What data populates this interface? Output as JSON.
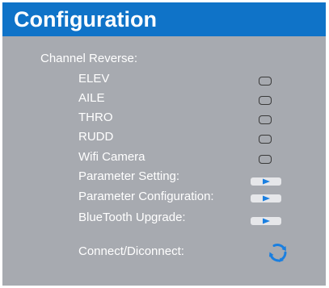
{
  "header": {
    "title": "Configuration"
  },
  "channel_reverse": {
    "label": "Channel Reverse:",
    "items": [
      {
        "label": "ELEV",
        "checked": false
      },
      {
        "label": "AILE",
        "checked": false
      },
      {
        "label": "THRO",
        "checked": false
      },
      {
        "label": "RUDD",
        "checked": false
      },
      {
        "label": "Wifi Camera",
        "checked": false
      }
    ]
  },
  "actions": [
    {
      "label": "Parameter Setting:",
      "icon": "play-icon"
    },
    {
      "label": "Parameter Configuration:",
      "icon": "play-icon"
    },
    {
      "label": "BlueTooth Upgrade:",
      "icon": "play-icon"
    }
  ],
  "connection": {
    "label": "Connect/Diconnect:",
    "icon": "refresh-icon"
  },
  "colors": {
    "title_bar": "#0f73c8",
    "panel_background": "#a7aab0",
    "text": "#ffffff",
    "accent_blue": "#1a7fe0",
    "button_fill": "#e6e7ea"
  }
}
